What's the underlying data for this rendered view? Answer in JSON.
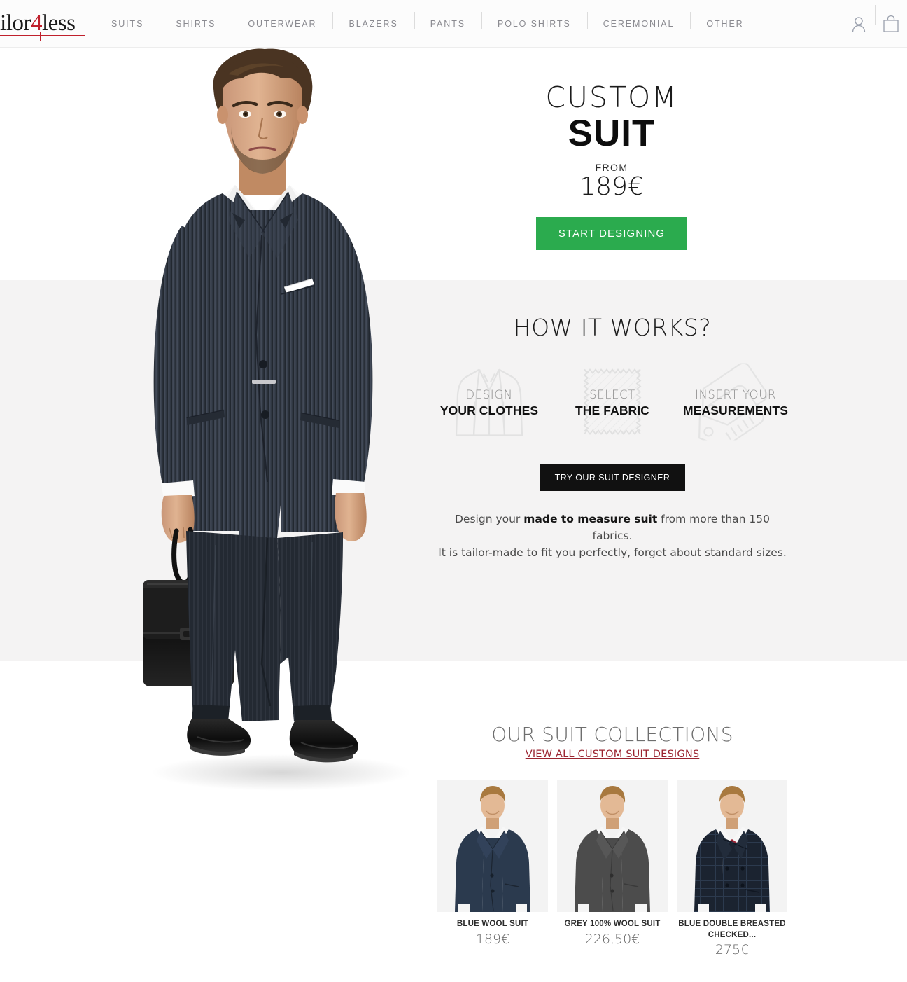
{
  "header": {
    "logo": {
      "prefix": "ailor",
      "accent": "4",
      "suffix": "less"
    },
    "nav": [
      {
        "label": "SUITS"
      },
      {
        "label": "SHIRTS"
      },
      {
        "label": "OUTERWEAR"
      },
      {
        "label": "BLAZERS"
      },
      {
        "label": "PANTS"
      },
      {
        "label": "POLO SHIRTS"
      },
      {
        "label": "CEREMONIAL"
      },
      {
        "label": "OTHER"
      }
    ],
    "icons": [
      {
        "name": "user-account-icon"
      },
      {
        "name": "shopping-bag-icon"
      }
    ]
  },
  "hero": {
    "title_light": "CUSTOM",
    "title_bold": "SUIT",
    "from_label": "FROM",
    "price": "189€",
    "cta": "START DESIGNING"
  },
  "how_it_works": {
    "title": "HOW IT WORKS?",
    "steps": [
      {
        "line1": "DESIGN",
        "line2": "YOUR CLOTHES",
        "icon": "jacket-icon"
      },
      {
        "line1": "SELECT",
        "line2": "THE FABRIC",
        "icon": "fabric-swatch-icon"
      },
      {
        "line1": "INSERT YOUR",
        "line2": "MEASUREMENTS",
        "icon": "price-tag-icon"
      }
    ],
    "cta": "TRY OUR SUIT DESIGNER",
    "desc_1": "Design your ",
    "desc_bold": "made to measure suit",
    "desc_2": " from more than 150 fabrics.",
    "desc_line2": "It is tailor-made to fit you perfectly, forget about standard sizes."
  },
  "collections": {
    "title": "OUR SUIT COLLECTIONS",
    "link": "VIEW ALL CUSTOM SUIT DESIGNS",
    "products": [
      {
        "name": "BLUE WOOL SUIT",
        "price": "189€",
        "suit_color": "#2b3murk",
        "tie": "blue"
      },
      {
        "name": "GREY 100% WOOL SUIT",
        "price": "226,50€",
        "tie": "blue"
      },
      {
        "name": "BLUE DOUBLE BREASTED CHECKED...",
        "price": "275€",
        "tie": "red"
      }
    ]
  },
  "colors": {
    "accent_green": "#2bab4e",
    "logo_red": "#c0202c",
    "link_red": "#9b2430",
    "band_grey": "#f4f3f3",
    "black_button": "#111111"
  }
}
